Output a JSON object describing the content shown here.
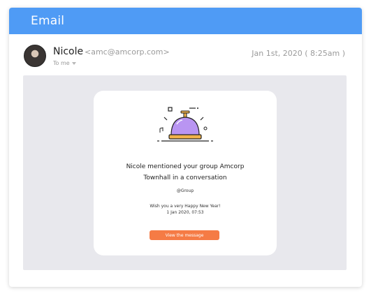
{
  "header": {
    "title": "Email"
  },
  "sender": {
    "name": "Nicole",
    "email": "<amc@amcorp.com>",
    "to_label": "To me"
  },
  "date": "Jan 1st, 2020 ( 8:25am )",
  "message": {
    "line1": "Nicole mentioned your group Amcorp",
    "line2": "Townhall  in a conversation",
    "group_tag": "@Group",
    "wish": "Wish you a very Happy New Year!",
    "timestamp": "1 Jan 2020, 07:53",
    "button_label": "View the message"
  },
  "colors": {
    "header": "#4f9bf5",
    "button": "#f57b45",
    "bell": "#b995f2",
    "bell_accent": "#f1b24a"
  },
  "icons": {
    "illustration": "bell-icon",
    "recipient_toggle": "chevron-down-icon"
  }
}
